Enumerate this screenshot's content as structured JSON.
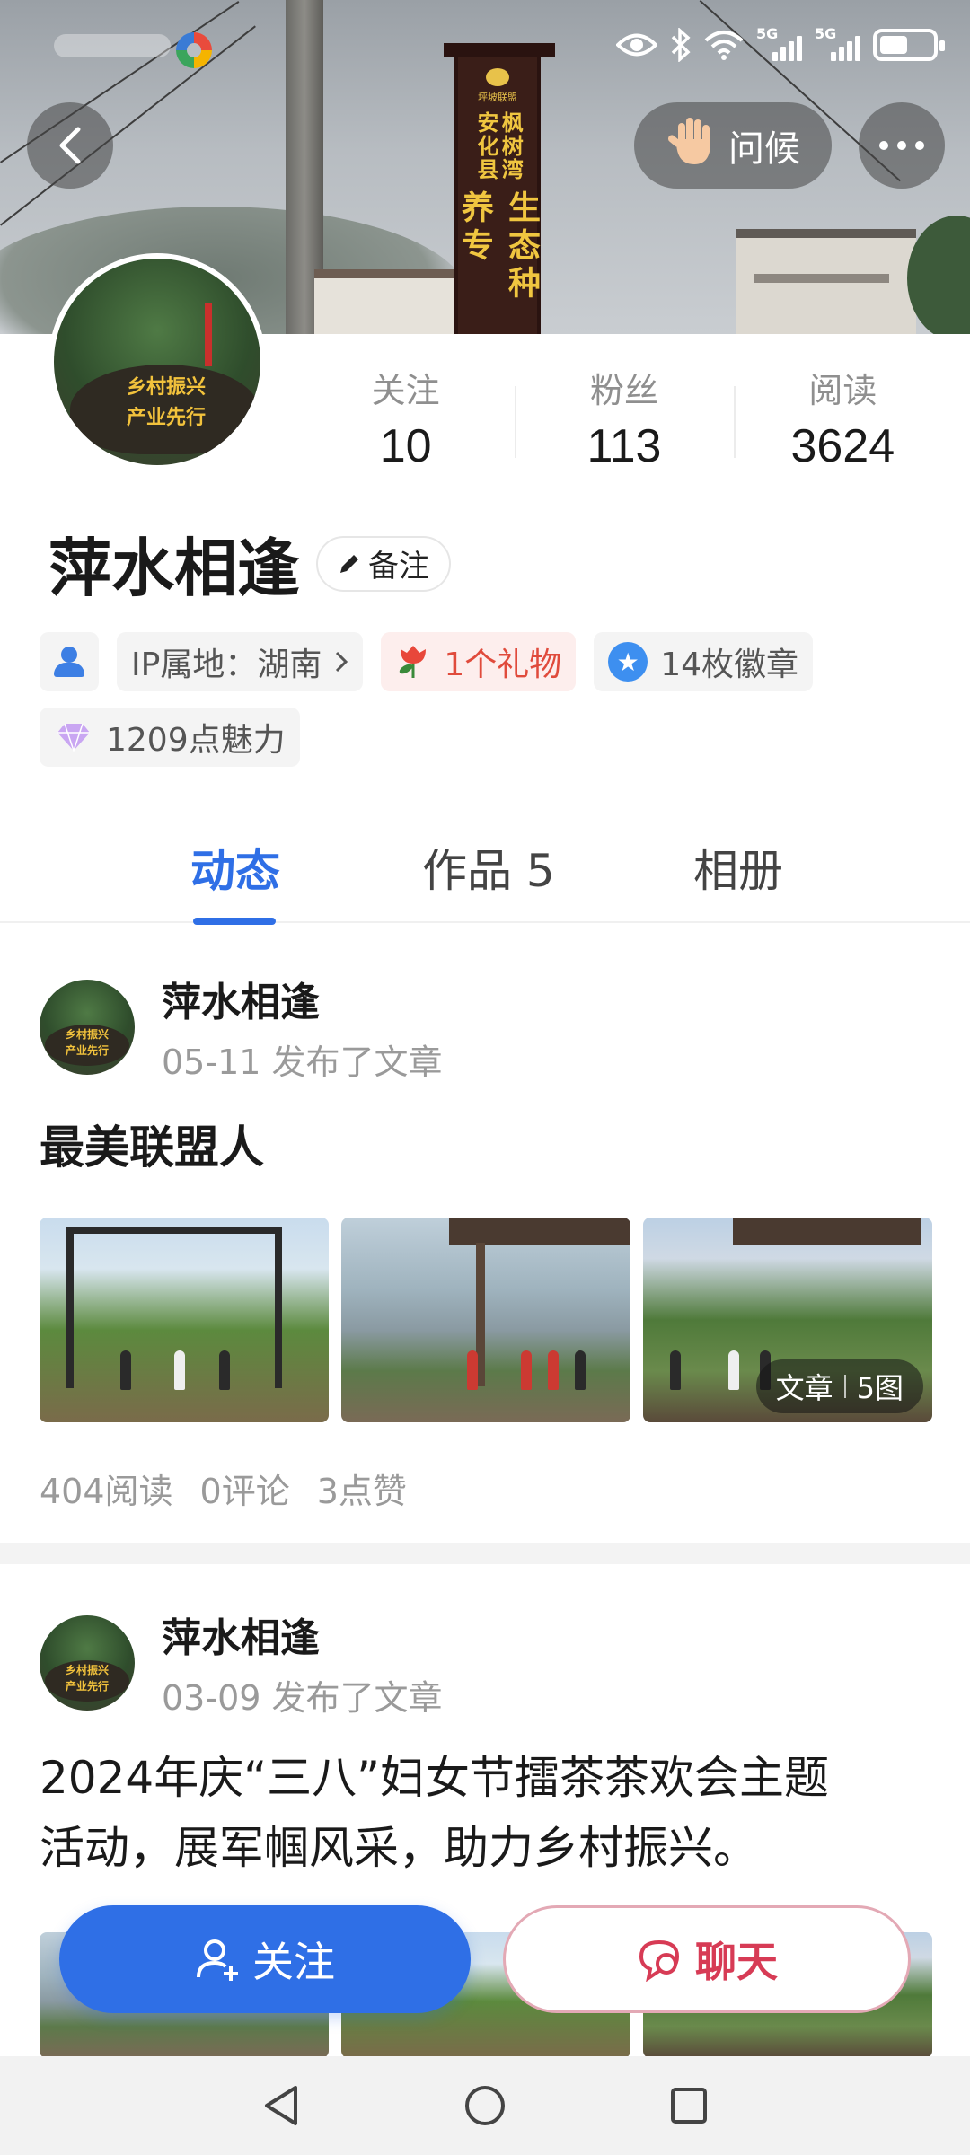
{
  "cover": {
    "sign": {
      "small": "坪坡联盟",
      "col1": "枫树湾",
      "col2": "安化县",
      "big": "生态种养专"
    }
  },
  "header": {
    "greet_label": "问候"
  },
  "profile": {
    "name": "萍水相逢",
    "remark_label": "备注",
    "avatar_text": [
      "乡村振兴",
      "产业先行"
    ],
    "stats": [
      {
        "label": "关注",
        "value": "10"
      },
      {
        "label": "粉丝",
        "value": "113"
      },
      {
        "label": "阅读",
        "value": "3624"
      }
    ],
    "ip_location": "IP属地：湖南",
    "gift": "1个礼物",
    "badges": "14枚徽章",
    "charm": "1209点魅力"
  },
  "tabs": [
    {
      "label": "动态",
      "active": true
    },
    {
      "label": "作品 5",
      "active": false
    },
    {
      "label": "相册",
      "active": false
    }
  ],
  "posts": [
    {
      "author": "萍水相逢",
      "meta": "05-11 发布了文章",
      "title": "最美联盟人",
      "overlay_type": "文章",
      "overlay_count": "5图",
      "reads": "404阅读",
      "comments": "0评论",
      "likes": "3点赞"
    },
    {
      "author": "萍水相逢",
      "meta": "03-09 发布了文章",
      "title_line1": "2024年庆“三八”妇女节擂茶茶欢会主题",
      "title_line2": "活动，展军帼风采，助力乡村振兴。"
    }
  ],
  "actions": {
    "follow_label": "关注",
    "chat_label": "聊天"
  },
  "colors": {
    "accent": "#2f6fe6",
    "chat": "#d73b55",
    "gift": "#e04b3c"
  }
}
